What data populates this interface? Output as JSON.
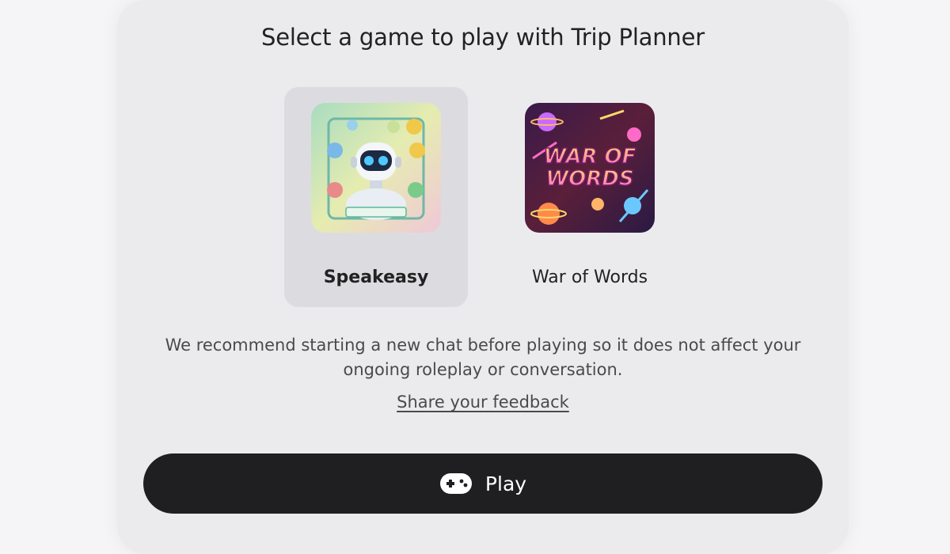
{
  "modal": {
    "title": "Select a game to play with Trip Planner"
  },
  "games": [
    {
      "name": "Speakeasy",
      "selected": true,
      "thumbnail_icon": "robot-game-thumbnail",
      "badge_text": "SPEAKEASY"
    },
    {
      "name": "War of Words",
      "selected": false,
      "thumbnail_icon": "war-of-words-game-thumbnail",
      "logo_text": [
        "WAR OF",
        "WORDS"
      ]
    }
  ],
  "note": {
    "line1": "We recommend starting a new chat before playing so it does not affect your",
    "line2": "ongoing roleplay or conversation."
  },
  "feedback_link": "Share your feedback",
  "play_button": {
    "label": "Play",
    "icon": "gamepad-icon"
  },
  "colors": {
    "modal_bg": "#ebebee",
    "selected_card_bg": "#dcdce0",
    "button_bg": "#1f1f22"
  }
}
